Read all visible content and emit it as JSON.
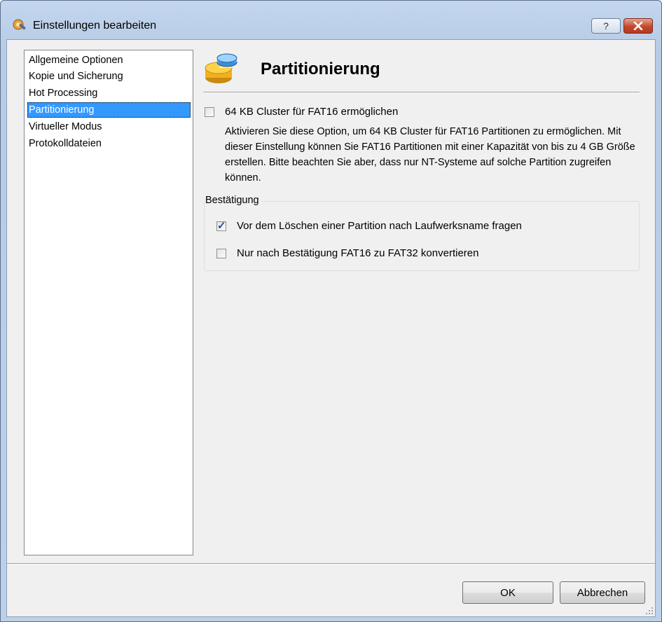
{
  "window": {
    "title": "Einstellungen bearbeiten",
    "help_label": "?",
    "close_label": "✕"
  },
  "sidebar": {
    "items": [
      {
        "label": "Allgemeine Optionen",
        "selected": false
      },
      {
        "label": "Kopie und Sicherung",
        "selected": false
      },
      {
        "label": "Hot Processing",
        "selected": false
      },
      {
        "label": "Partitionierung",
        "selected": true
      },
      {
        "label": "Virtueller Modus",
        "selected": false
      },
      {
        "label": "Protokolldateien",
        "selected": false
      }
    ]
  },
  "page": {
    "title": "Partitionierung",
    "option_fat16_cluster": {
      "label": "64 KB Cluster für FAT16 ermöglichen",
      "checked": false,
      "description": "Aktivieren Sie diese Option, um 64 KB Cluster für FAT16 Partitionen zu ermöglichen. Mit dieser Einstellung können Sie FAT16 Partitionen mit einer Kapazität von bis zu 4 GB Größe erstellen. Bitte beachten Sie aber, dass nur NT-Systeme auf solche Partition zugreifen können."
    },
    "confirmation_group": {
      "label": "Bestätigung",
      "options": [
        {
          "label": "Vor dem Löschen einer Partition nach Laufwerksname fragen",
          "checked": true
        },
        {
          "label": "Nur nach Bestätigung FAT16 zu FAT32 konvertieren",
          "checked": false
        }
      ]
    }
  },
  "footer": {
    "ok_label": "OK",
    "cancel_label": "Abbrechen"
  },
  "colors": {
    "selection": "#3399ff",
    "title_bar": "#c3d6ee",
    "close_button": "#c2482f"
  }
}
